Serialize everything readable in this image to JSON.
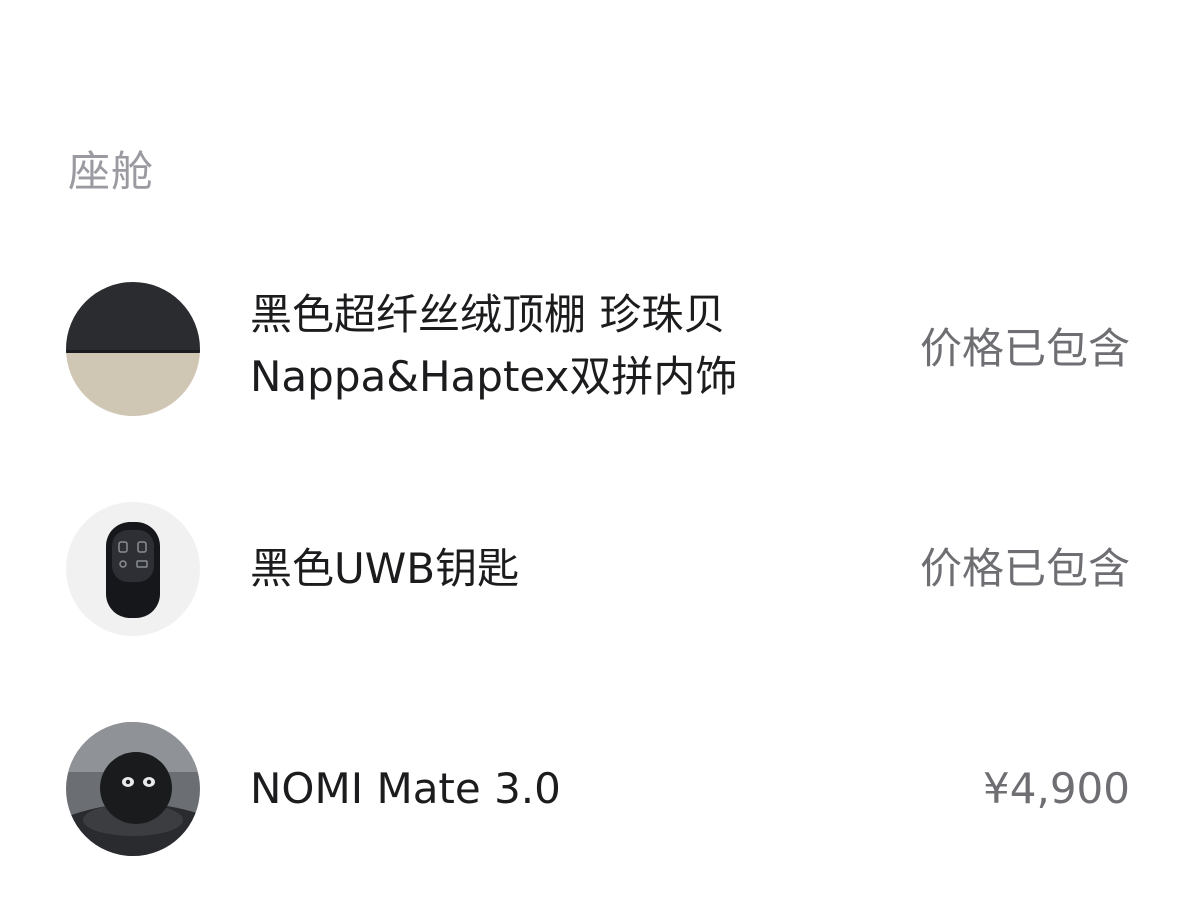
{
  "section": {
    "title": "座舱"
  },
  "items": [
    {
      "name_line1": "黑色超纤丝绒顶棚 珍珠贝",
      "name_line2": "Nappa&Haptex双拼内饰",
      "price": "价格已包含",
      "icon": "interior-swatch-thumbnail"
    },
    {
      "name": "黑色UWB钥匙",
      "price": "价格已包含",
      "icon": "uwb-key-thumbnail"
    },
    {
      "name": "NOMI Mate 3.0",
      "price": "¥4,900",
      "icon": "nomi-mate-thumbnail"
    }
  ],
  "colors": {
    "section_title": "#9a9aa0",
    "item_text": "#1c1c1e",
    "price_text": "#6e6e73",
    "background": "#ffffff"
  }
}
